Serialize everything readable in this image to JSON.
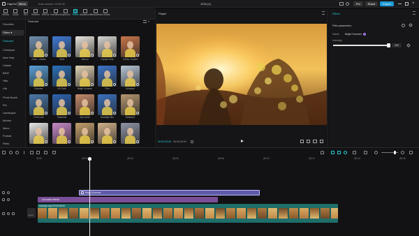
{
  "app": {
    "name": "CapCut",
    "menu_label": "Menu",
    "autosave_text": "Auto saved: 14:09:32",
    "project_title": "1218 (1)",
    "pro_label": "Pro",
    "share_label": "Share",
    "export_label": "Export"
  },
  "toolbar": {
    "items": [
      {
        "label": "Media",
        "icon": "media-icon"
      },
      {
        "label": "Audio",
        "icon": "audio-icon"
      },
      {
        "label": "Text",
        "icon": "text-icon"
      },
      {
        "label": "Stickers",
        "icon": "stickers-icon"
      },
      {
        "label": "Effects",
        "icon": "effects-icon"
      },
      {
        "label": "Transitions",
        "icon": "transitions-icon"
      },
      {
        "label": "Captions",
        "icon": "captions-icon"
      },
      {
        "label": "Filters",
        "icon": "filters-icon",
        "active": true
      },
      {
        "label": "Adjustment",
        "icon": "adjustment-icon"
      },
      {
        "label": "Templates",
        "icon": "templates-icon"
      },
      {
        "label": "AI avatar",
        "icon": "ai-avatar-icon"
      }
    ]
  },
  "sidebar": {
    "items": [
      {
        "label": "Favorites"
      },
      {
        "label": "Filters ▾",
        "selected": true
      },
      {
        "label": "Featured",
        "highlight": true
      },
      {
        "label": "Christmas"
      },
      {
        "label": "New Year"
      },
      {
        "label": "Classic"
      },
      {
        "label": "B&W"
      },
      {
        "label": "Hills"
      },
      {
        "label": "Life"
      },
      {
        "label": "Photo Booth"
      },
      {
        "label": "Pet"
      },
      {
        "label": "Landscape"
      },
      {
        "label": "Movies"
      },
      {
        "label": "Mono"
      },
      {
        "label": "Portrait"
      },
      {
        "label": "Retro"
      }
    ]
  },
  "gallery": {
    "section_label": "Featured",
    "thumbs": [
      {
        "label": "Clear ...ulance",
        "bg": "#6f8fb0"
      },
      {
        "label": "Vivid",
        "bg": "#3f7ad6"
      },
      {
        "label": "Natural",
        "bg": "#e8e4dc"
      },
      {
        "label": "Crystal Clear",
        "bg": "#d8d6d2"
      },
      {
        "label": "Drinks, Sunset",
        "bg": "#c9764a"
      },
      {
        "label": "Summer",
        "bg": "#5aa0d8"
      },
      {
        "label": "HD Dark",
        "bg": "#2b6fb8"
      },
      {
        "label": "Bright Summer",
        "bg": "#e0d3b4"
      },
      {
        "label": "Film",
        "bg": "#3d74c8"
      },
      {
        "label": "Enhance",
        "bg": "#b8c6d6"
      },
      {
        "label": "Fresh one",
        "bg": "#4a78aa"
      },
      {
        "label": "Snapshot",
        "bg": "#2e64b0"
      },
      {
        "label": "Spot clear",
        "bg": "#c58a6a"
      },
      {
        "label": "Backlight film",
        "bg": "#3c72c0"
      },
      {
        "label": "Radiance",
        "bg": "#b59770"
      },
      {
        "label": "",
        "bg": "#e8e6e6"
      },
      {
        "label": "",
        "bg": "#c88ac8"
      },
      {
        "label": "",
        "bg": "#c4a06c"
      },
      {
        "label": "",
        "bg": "#d2b28a"
      },
      {
        "label": "",
        "bg": "#8f94a6"
      }
    ]
  },
  "player": {
    "title": "Player",
    "current_time": "00:00:05:06",
    "total_time": "00:00:06:00"
  },
  "inspector": {
    "title": "Filters",
    "panel_label": "Filter parameters",
    "name_label": "Name",
    "name_value": "Bright Summer",
    "intensity_label": "Intensity",
    "intensity_value": "100",
    "intensity_fraction": 1.0
  },
  "timeline": {
    "ruler": [
      "00:00",
      "|00:02",
      "|00:04",
      "|00:06",
      "|00:08",
      "|00:10",
      "|00:12",
      "|00:14",
      "|00:16"
    ],
    "clips": {
      "filter": {
        "label": "Bright Summer",
        "color": "#5f5aa8"
      },
      "effect": {
        "label": "Animated effects",
        "color": "#7a4f98"
      },
      "video": {
        "label": "example.mp4   00:00:06:00",
        "color": "#1f6e6a"
      }
    },
    "cover_label": "Cover"
  },
  "colors": {
    "accent": "#25d0da",
    "export": "#1b9ad6"
  }
}
